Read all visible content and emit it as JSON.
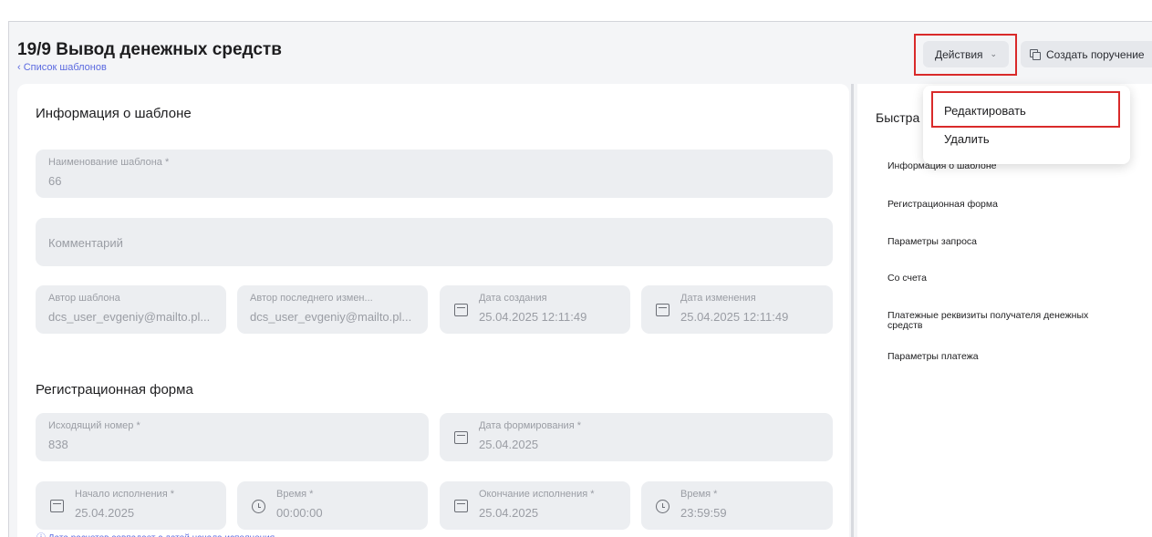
{
  "header": {
    "title": "19/9 Вывод денежных средств",
    "breadcrumb": "‹ Список шаблонов",
    "actions_label": "Действия",
    "create_label": "Создать поручение"
  },
  "dropdown": {
    "items": [
      {
        "label": "Редактировать"
      },
      {
        "label": "Удалить"
      }
    ]
  },
  "template_info": {
    "section_title": "Информация о шаблоне",
    "name_label": "Наименование шаблона *",
    "name_value": "66",
    "comment_placeholder": "Комментарий",
    "author_label": "Автор шаблона",
    "author_value": "dcs_user_evgeniy@mailto.pl...",
    "last_editor_label": "Автор последнего измен...",
    "last_editor_value": "dcs_user_evgeniy@mailto.pl...",
    "created_label": "Дата создания",
    "created_value": "25.04.2025 12:11:49",
    "modified_label": "Дата изменения",
    "modified_value": "25.04.2025 12:11:49"
  },
  "registration": {
    "section_title": "Регистрационная форма",
    "outgoing_label": "Исходящий номер *",
    "outgoing_value": "838",
    "formed_label": "Дата формирования *",
    "formed_value": "25.04.2025",
    "start_label": "Начало исполнения *",
    "start_value": "25.04.2025",
    "start_time_label": "Время *",
    "start_time_value": "00:00:00",
    "end_label": "Окончание исполнения *",
    "end_value": "25.04.2025",
    "end_time_label": "Время *",
    "end_time_value": "23:59:59",
    "hint": "ⓘ Дата расчетов совпадает с датой начала исполнения"
  },
  "quick_nav": {
    "title": "Быстра",
    "items": [
      "Информация о шаблоне",
      "Регистрационная форма",
      "Параметры запроса",
      "Со счета",
      "Платежные реквизиты получателя денежных средств",
      "Параметры платежа"
    ]
  },
  "colors": {
    "accent": "#5b6ae0",
    "highlight": "#d92a2a",
    "field_bg": "#eceef1",
    "page_bg": "#f4f5f7"
  }
}
